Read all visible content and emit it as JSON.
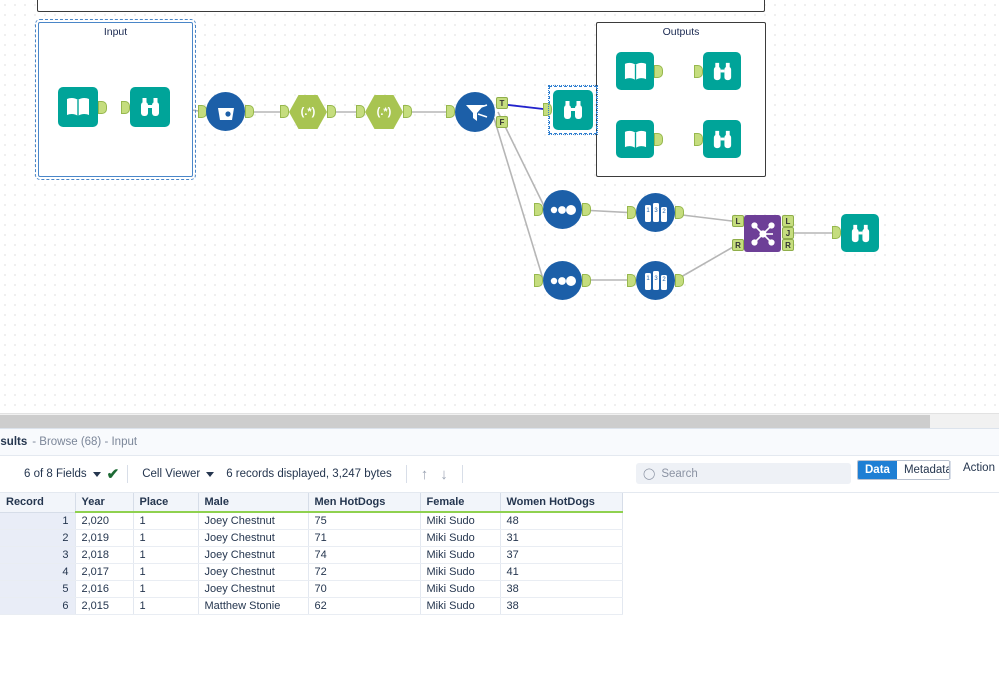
{
  "canvas": {
    "containers": [
      {
        "name": "input-container",
        "title": "Input",
        "selected": true
      },
      {
        "name": "outputs-container",
        "title": "Outputs",
        "selected": false
      },
      {
        "name": "top-partial-container",
        "title": "",
        "selected": false
      }
    ],
    "tools": [
      {
        "name": "input-data-tool",
        "icon": "book-icon",
        "label": "Input Data"
      },
      {
        "name": "browse-tool-1",
        "icon": "binoculars-icon",
        "label": "Browse"
      },
      {
        "name": "data-cleansing-tool",
        "icon": "bucket-drops-icon",
        "label": "Data Cleansing"
      },
      {
        "name": "regex-tool-1",
        "icon": "regex-icon",
        "label": "RegEx"
      },
      {
        "name": "regex-tool-2",
        "icon": "regex-icon",
        "label": "RegEx"
      },
      {
        "name": "filter-tool",
        "icon": "funnel-icon",
        "label": "Filter"
      },
      {
        "name": "browse-tool-selected",
        "icon": "binoculars-icon",
        "label": "Browse"
      },
      {
        "name": "select-tool-1",
        "icon": "select-dots-icon",
        "label": "Select"
      },
      {
        "name": "select-tool-2",
        "icon": "select-dots-icon",
        "label": "Select"
      },
      {
        "name": "sort-tool-1",
        "icon": "sort-bars-icon",
        "label": "Sort"
      },
      {
        "name": "sort-tool-2",
        "icon": "sort-bars-icon",
        "label": "Sort"
      },
      {
        "name": "join-tool",
        "icon": "join-nodes-icon",
        "label": "Join"
      },
      {
        "name": "browse-tool-final",
        "icon": "binoculars-icon",
        "label": "Browse"
      },
      {
        "name": "output-book-1",
        "icon": "book-icon",
        "label": "Input Data"
      },
      {
        "name": "output-browse-1",
        "icon": "binoculars-icon",
        "label": "Browse"
      },
      {
        "name": "output-book-2",
        "icon": "book-icon",
        "label": "Input Data"
      },
      {
        "name": "output-browse-2",
        "icon": "binoculars-icon",
        "label": "Browse"
      }
    ],
    "anchor_labels": {
      "filter_true": "T",
      "filter_false": "F",
      "join_left": "L",
      "join_inner": "J",
      "join_right": "R"
    },
    "colors": {
      "teal": "#00a499",
      "blue": "#1c5fa8",
      "green": "#a8c451",
      "purple": "#6d3f97",
      "anchor": "#c5dd7e",
      "wire": "#b6b6b6",
      "wire_selected": "#2222cc"
    }
  },
  "results": {
    "title": "esults",
    "subtitle": "- Browse (68) - Input",
    "toolbar": {
      "fields_label": "6 of 8 Fields",
      "viewer_label": "Cell Viewer",
      "records_label": "6 records displayed, 3,247 bytes",
      "up_arrow": "↑",
      "down_arrow": "↓",
      "check_mark": "✔"
    },
    "search": {
      "placeholder": "Search",
      "value": "",
      "icon": "search-icon"
    },
    "segmented": {
      "data_label": "Data",
      "metadata_label": "Metadata",
      "selected": "Data"
    },
    "actions_label": "Action",
    "table": {
      "columns": [
        "Record",
        "Year",
        "Place",
        "Male",
        "Men HotDogs",
        "Female",
        "Women HotDogs"
      ],
      "rows": [
        [
          "1",
          "2,020",
          "1",
          "Joey Chestnut",
          "75",
          "Miki Sudo",
          "48"
        ],
        [
          "2",
          "2,019",
          "1",
          "Joey Chestnut",
          "71",
          "Miki Sudo",
          "31"
        ],
        [
          "3",
          "2,018",
          "1",
          "Joey Chestnut",
          "74",
          "Miki Sudo",
          "37"
        ],
        [
          "4",
          "2,017",
          "1",
          "Joey Chestnut",
          "72",
          "Miki Sudo",
          "41"
        ],
        [
          "5",
          "2,016",
          "1",
          "Joey Chestnut",
          "70",
          "Miki Sudo",
          "38"
        ],
        [
          "6",
          "2,015",
          "1",
          "Matthew Stonie",
          "62",
          "Miki Sudo",
          "38"
        ]
      ]
    }
  }
}
